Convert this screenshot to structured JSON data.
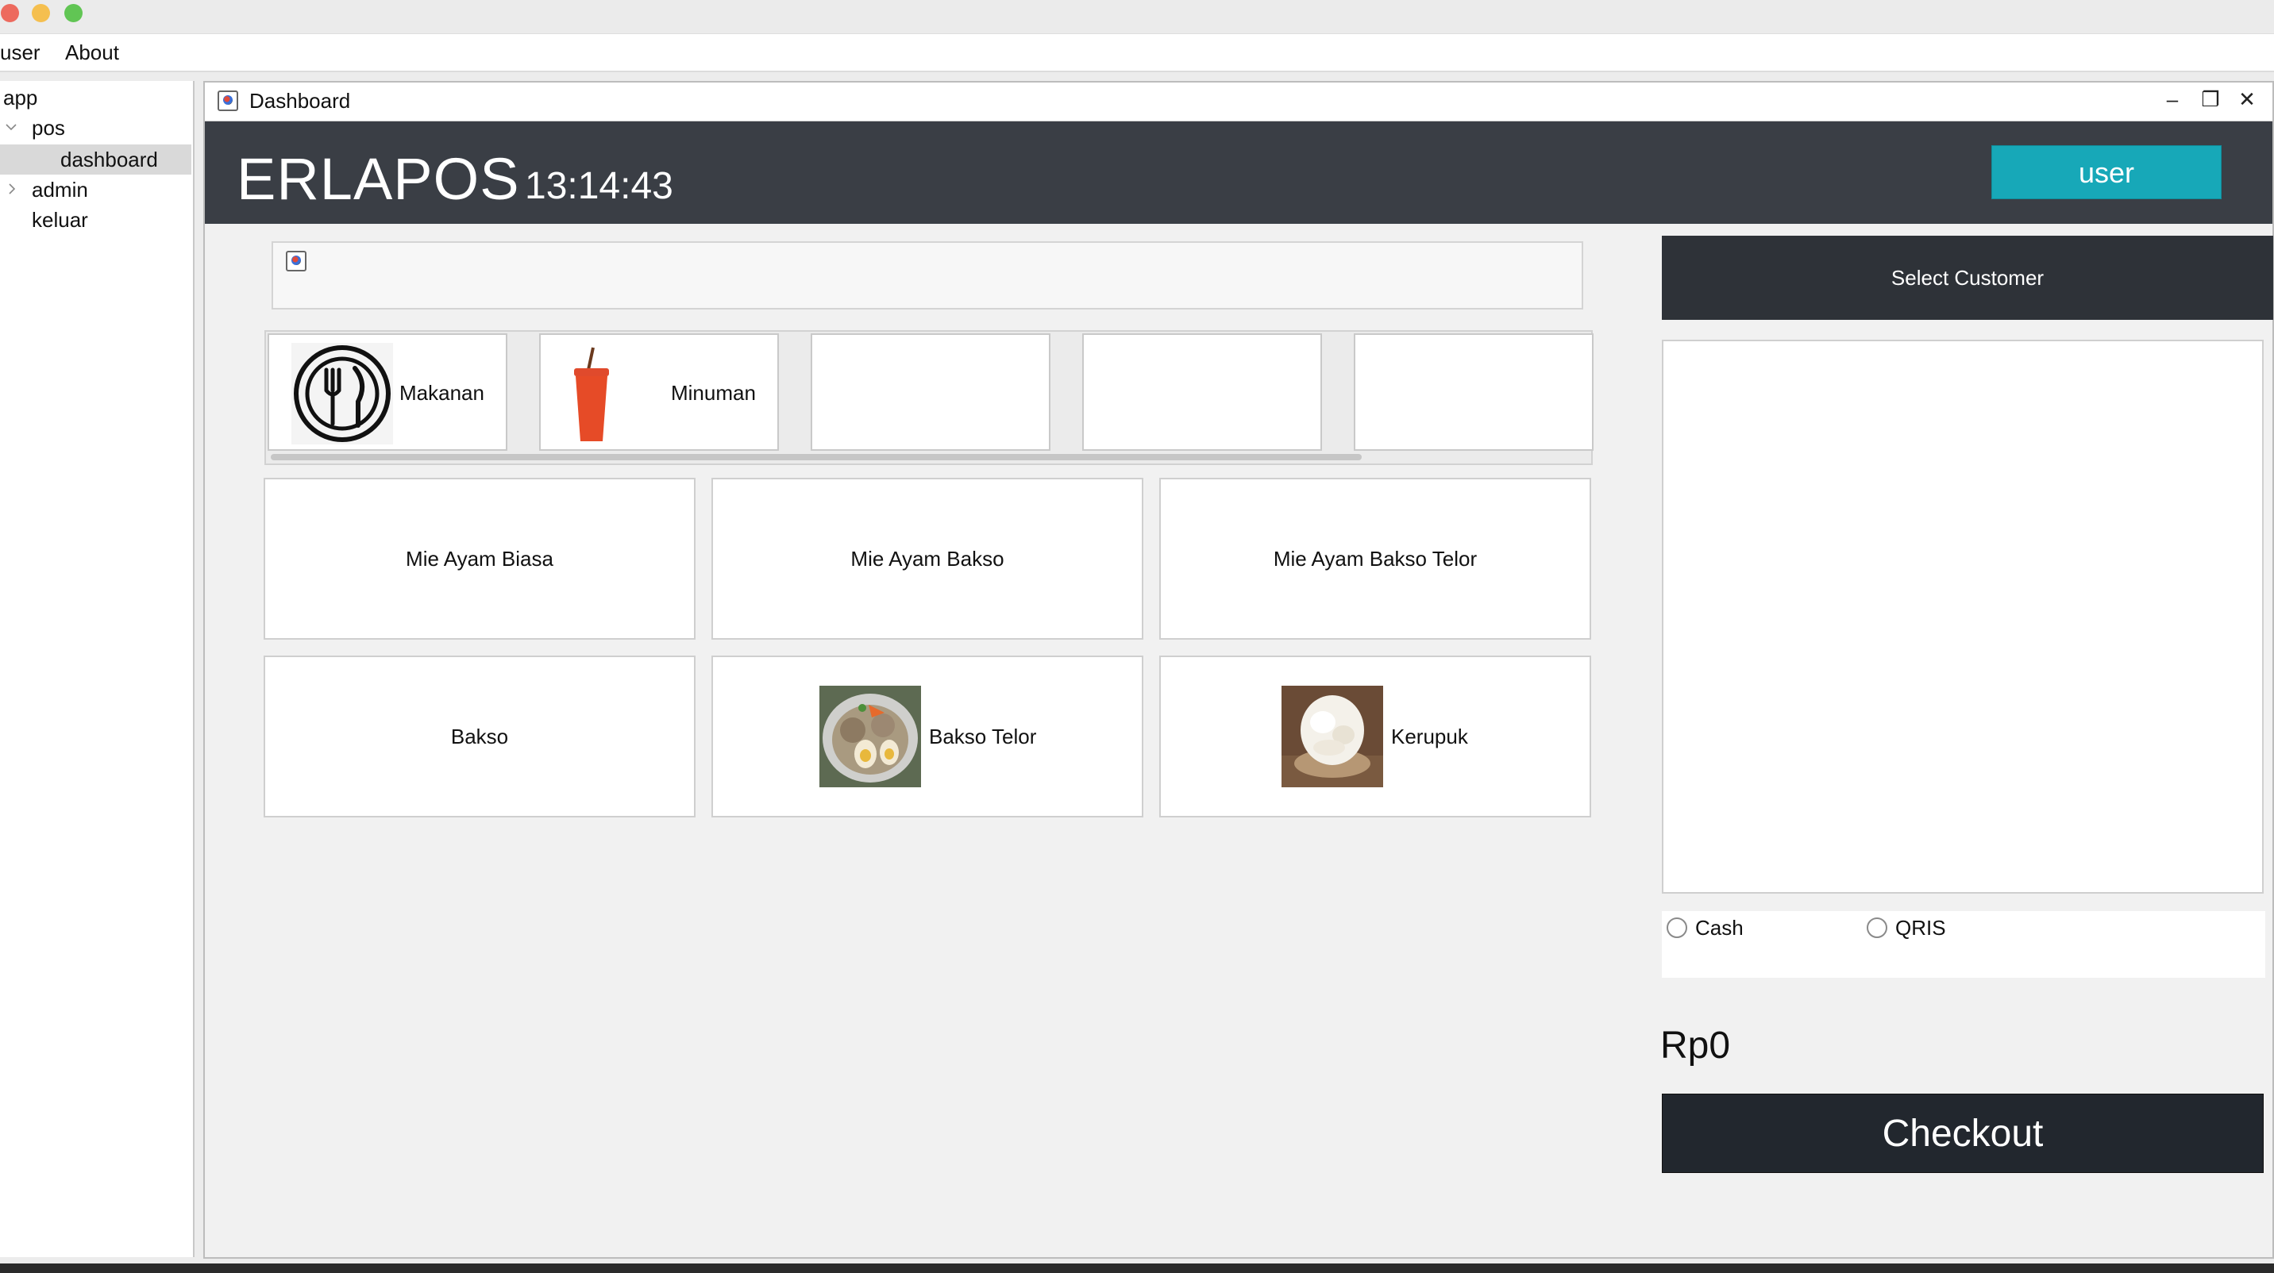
{
  "menubar": {
    "items": [
      "user",
      "About"
    ]
  },
  "tree": {
    "root": "app",
    "items": [
      {
        "label": "pos",
        "expanded": true
      },
      {
        "label": "dashboard",
        "selected": true
      },
      {
        "label": "admin",
        "expanded": false
      },
      {
        "label": "keluar"
      }
    ]
  },
  "window": {
    "title": "Dashboard",
    "minimize": "–",
    "restore": "❐",
    "close": "✕"
  },
  "header": {
    "brand": "ERLAPOS",
    "clock": "13:14:43",
    "user_button": "user",
    "accent": "#17a8b8",
    "background": "#3a3e45"
  },
  "categories": [
    {
      "label": "Makanan",
      "icon": "plate-fork-knife-icon"
    },
    {
      "label": "Minuman",
      "icon": "drink-cup-icon"
    },
    {
      "label": ""
    },
    {
      "label": ""
    },
    {
      "label": ""
    }
  ],
  "products": [
    {
      "name": "Mie Ayam Biasa"
    },
    {
      "name": "Mie Ayam Bakso"
    },
    {
      "name": "Mie Ayam Bakso Telor"
    },
    {
      "name": "Bakso"
    },
    {
      "name": "Bakso Telor",
      "image": "bakso-telor-photo"
    },
    {
      "name": "Kerupuk",
      "image": "kerupuk-photo"
    }
  ],
  "right_panel": {
    "select_customer": "Select Customer",
    "payment_methods": [
      "Cash",
      "QRIS"
    ],
    "total": "Rp0",
    "checkout": "Checkout"
  }
}
